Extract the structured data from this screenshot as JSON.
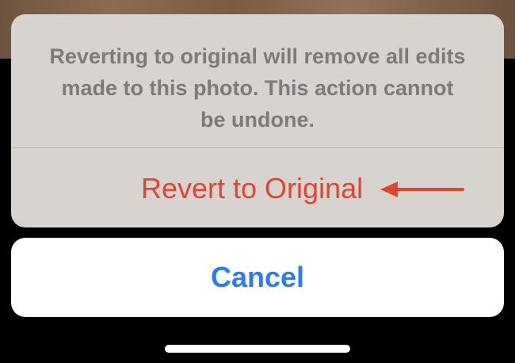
{
  "action_sheet": {
    "message_lines": [
      "Reverting to original will remove all edits",
      "made to this photo. This action cannot",
      "be undone."
    ],
    "destructive_action_label": "Revert to Original"
  },
  "cancel_button": {
    "label": "Cancel"
  },
  "annotation": {
    "arrow_icon": "left-arrow-icon",
    "arrow_color": "#e2442f"
  },
  "colors": {
    "background": "#000000",
    "sheet_background": "#d7d4d0",
    "message_text": "#7c7b79",
    "destructive_text": "#e2442f",
    "cancel_text": "#2f7bf5",
    "cancel_background": "#ffffff",
    "home_indicator": "#ffffff"
  }
}
